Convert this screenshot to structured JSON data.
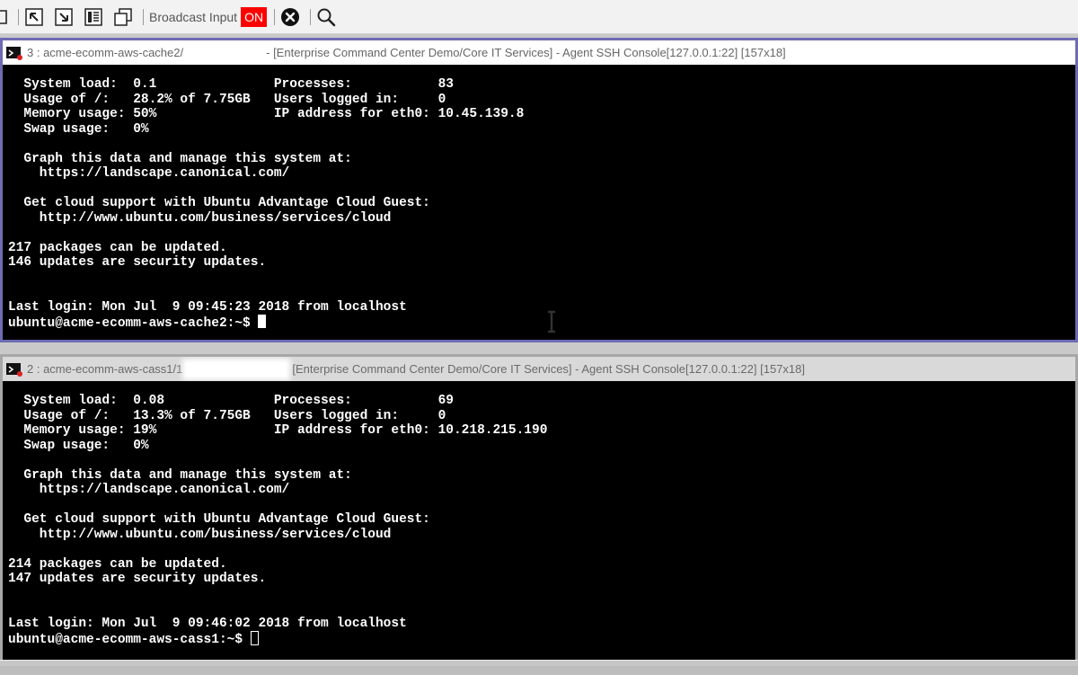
{
  "toolbar": {
    "broadcast_label": "Broadcast Input",
    "broadcast_state": "ON",
    "icons": [
      "pane-icon",
      "arrow-up-left-icon",
      "arrow-down-right-icon",
      "list-view-icon",
      "cascade-windows-icon",
      "close-circle-icon",
      "search-icon"
    ]
  },
  "consoles": [
    {
      "title_prefix": "3 : acme-ecomm-aws-cache2/",
      "title_suffix": "- [Enterprise Command Center Demo/Core IT Services] - Agent SSH Console[127.0.0.1:22] [157x18]",
      "lines": [
        "  System load:  0.1               Processes:           83",
        "  Usage of /:   28.2% of 7.75GB   Users logged in:     0",
        "  Memory usage: 50%               IP address for eth0: 10.45.139.8",
        "  Swap usage:   0%",
        "",
        "  Graph this data and manage this system at:",
        "    https://landscape.canonical.com/",
        "",
        "  Get cloud support with Ubuntu Advantage Cloud Guest:",
        "    http://www.ubuntu.com/business/services/cloud",
        "",
        "217 packages can be updated.",
        "146 updates are security updates.",
        "",
        "",
        "Last login: Mon Jul  9 09:45:23 2018 from localhost"
      ],
      "prompt": "ubuntu@acme-ecomm-aws-cache2:~$ "
    },
    {
      "title_prefix": "2 : acme-ecomm-aws-cass1/1",
      "title_suffix": "[Enterprise Command Center Demo/Core IT Services] - Agent SSH Console[127.0.0.1:22] [157x18]",
      "lines": [
        "  System load:  0.08              Processes:           69",
        "  Usage of /:   13.3% of 7.75GB   Users logged in:     0",
        "  Memory usage: 19%               IP address for eth0: 10.218.215.190",
        "  Swap usage:   0%",
        "",
        "  Graph this data and manage this system at:",
        "    https://landscape.canonical.com/",
        "",
        "  Get cloud support with Ubuntu Advantage Cloud Guest:",
        "    http://www.ubuntu.com/business/services/cloud",
        "",
        "214 packages can be updated.",
        "147 updates are security updates.",
        "",
        "",
        "Last login: Mon Jul  9 09:46:02 2018 from localhost"
      ],
      "prompt": "ubuntu@acme-ecomm-aws-cass1:~$ "
    }
  ],
  "colors": {
    "toggle_on": "#ff0000",
    "active_border": "#6d6bb3",
    "inactive_border": "#a7a7a7",
    "terminal_bg": "#000000",
    "terminal_fg": "#ffffff"
  }
}
